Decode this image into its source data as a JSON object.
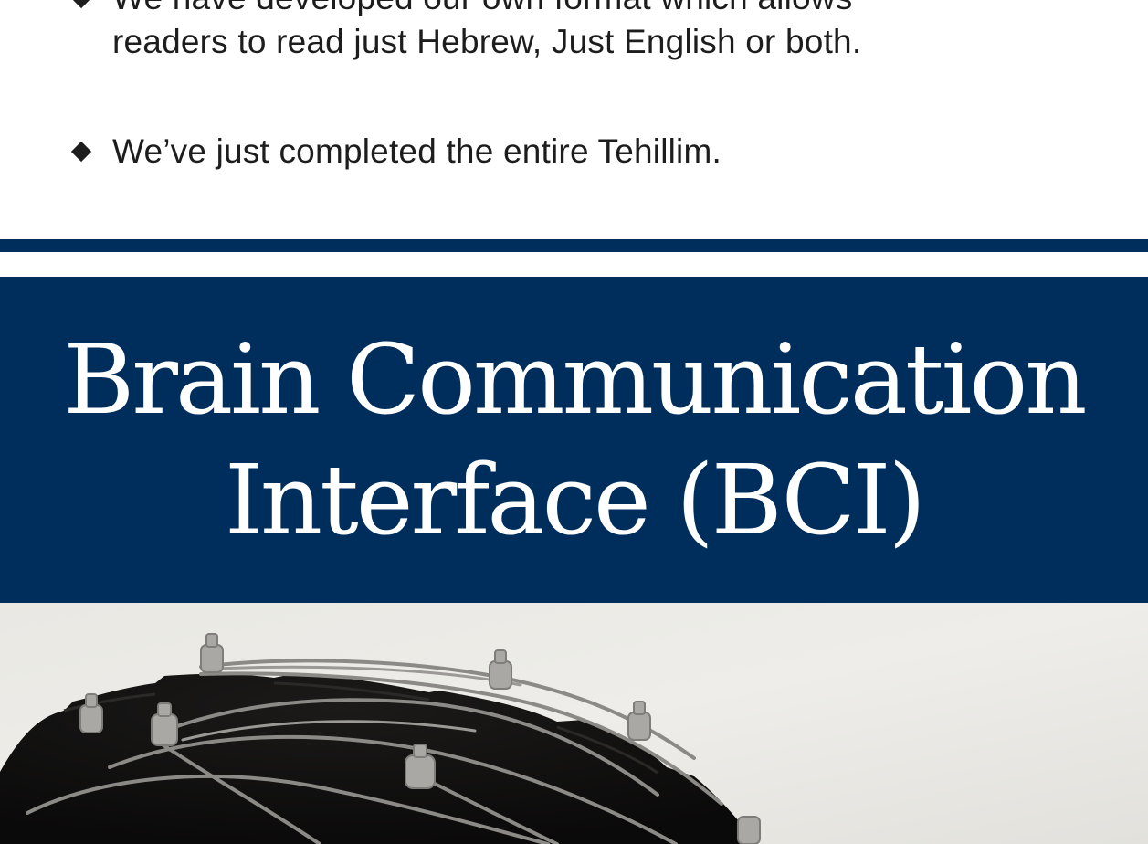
{
  "bullets": [
    {
      "line1": "We have developed our own format which allows",
      "line2": "readers to read just Hebrew, Just English or both."
    },
    {
      "line1": "We’ve just completed the entire Tehillim."
    }
  ],
  "banner": {
    "title_line1": "Brain Communication",
    "title_line2": "Interface (BCI)"
  },
  "colors": {
    "navy": "#002e5c",
    "text": "#1d1d1d"
  },
  "photo": {
    "subject": "eeg-electrode-cap"
  }
}
